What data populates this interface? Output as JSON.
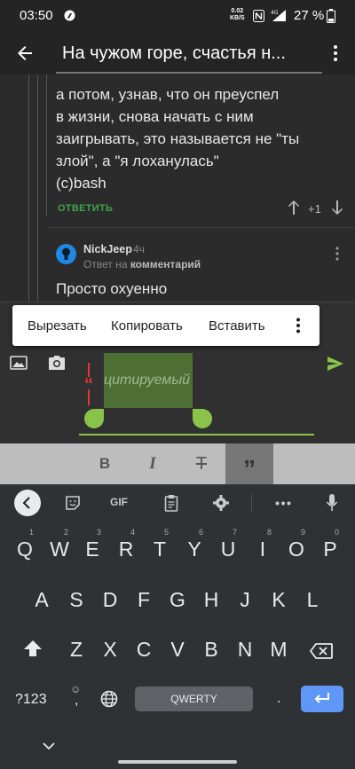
{
  "status_bar": {
    "time": "03:50",
    "speed_value": "0.02",
    "speed_unit": "KB/S",
    "network": "4G",
    "battery_pct": "27 %"
  },
  "app_bar": {
    "title": "На чужом горе, счастья н..."
  },
  "comment": {
    "lines": [
      "а потом, узнав, что он преуспел",
      "в жизни, снова начать с ним",
      "заигрывать, это называется не \"ты",
      "злой\", а \"я лоханулась\"",
      "(c)bash"
    ],
    "reply_label": "ОТВЕТИТЬ",
    "score": "+1"
  },
  "reply": {
    "username": "NickJeep",
    "age": "4ч",
    "reply_prefix": "Ответ на",
    "reply_target": "комментарий",
    "text": "Просто охуенно"
  },
  "selection_toolbar": {
    "cut": "Вырезать",
    "copy": "Копировать",
    "paste": "Вставить"
  },
  "composer": {
    "quote_text": "цитируемый"
  },
  "keyboard": {
    "gif_label": "GIF",
    "row1": [
      {
        "k": "Q",
        "h": "1"
      },
      {
        "k": "W",
        "h": "2"
      },
      {
        "k": "E",
        "h": "3"
      },
      {
        "k": "R",
        "h": "4"
      },
      {
        "k": "T",
        "h": "5"
      },
      {
        "k": "Y",
        "h": "6"
      },
      {
        "k": "U",
        "h": "7"
      },
      {
        "k": "I",
        "h": "8"
      },
      {
        "k": "O",
        "h": "9"
      },
      {
        "k": "P",
        "h": "0"
      }
    ],
    "row2": [
      "A",
      "S",
      "D",
      "F",
      "G",
      "H",
      "J",
      "K",
      "L"
    ],
    "row3": [
      "Z",
      "X",
      "C",
      "V",
      "B",
      "N",
      "M"
    ],
    "symbols_label": "?123",
    "space_label": "QWERTY",
    "period": "."
  },
  "colors": {
    "accent_green": "#8bc34a",
    "reply_green": "#3ea44a",
    "enter_blue": "#5e97f6",
    "avatar_blue": "#1e88e5",
    "quote_red": "#e53935"
  }
}
